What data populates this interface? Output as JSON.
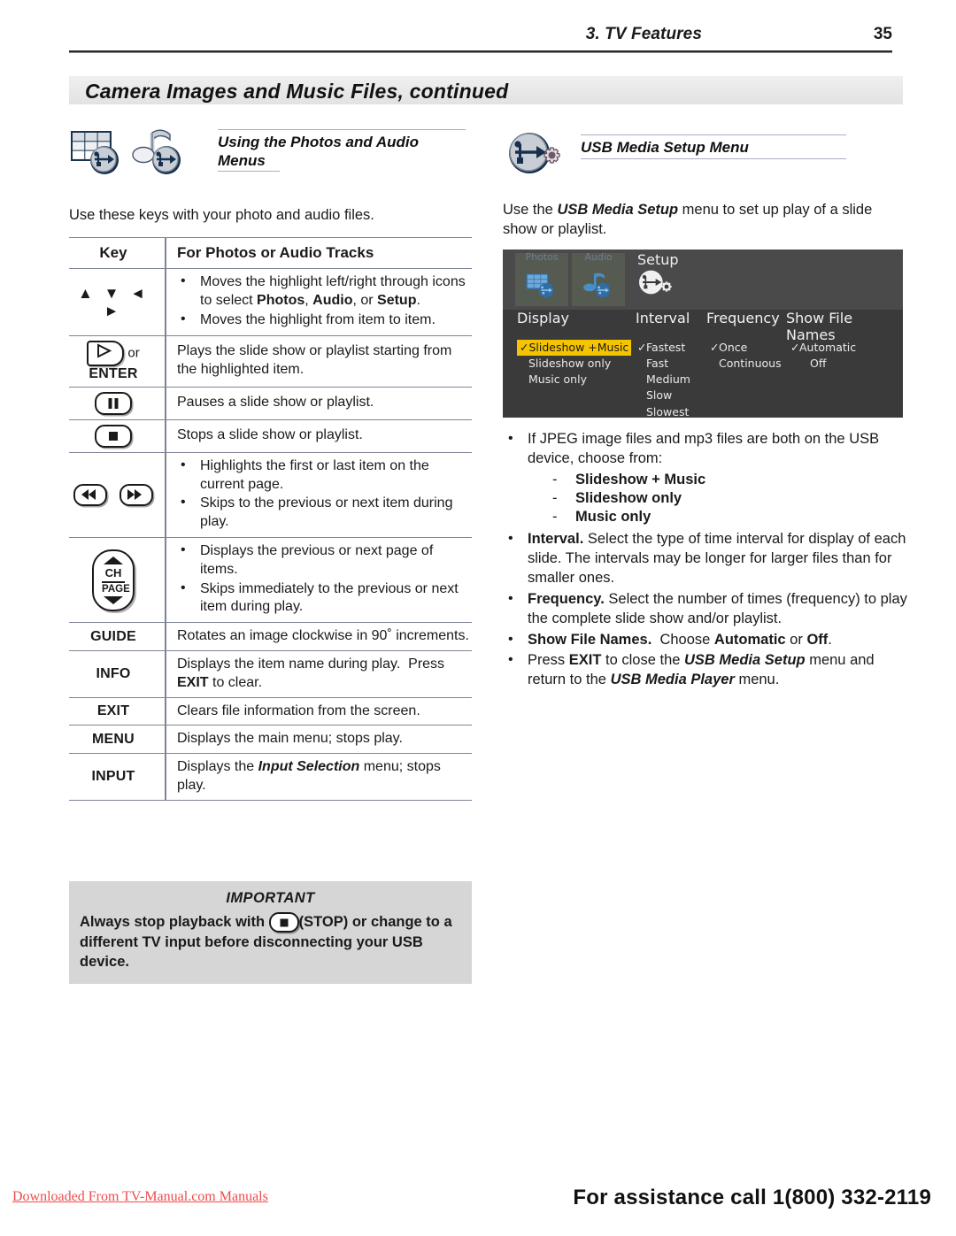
{
  "header": {
    "section": "3.  TV Features",
    "page_number": "35",
    "title": "Camera Images and Music Files, continued"
  },
  "left": {
    "section_title": "Using the Photos and Audio Menus",
    "intro": "Use these keys with your photo and audio files.",
    "icons": [
      "photos-usb-icon",
      "audio-usb-icon"
    ],
    "table": {
      "headers": [
        "Key",
        "For Photos or Audio Tracks"
      ],
      "rows": [
        {
          "key_type": "arrows",
          "key_label": "▲ ▼ ◄ ►",
          "bullets": [
            "Moves the highlight left/right through icons to select Photos, Audio, or Setup.",
            "Moves the highlight from item to item."
          ]
        },
        {
          "key_type": "play-enter",
          "key_label": "ENTER",
          "key_suffix": "or",
          "text": "Plays the slide show or playlist starting from the highlighted item."
        },
        {
          "key_type": "pause",
          "key_label": "",
          "text": "Pauses a slide show or playlist."
        },
        {
          "key_type": "stop",
          "key_label": "",
          "text": "Stops a slide show or playlist."
        },
        {
          "key_type": "rew-ff",
          "key_label": "",
          "bullets": [
            "Highlights the first or last item on the current page.",
            "Skips to the previous or next item during play."
          ]
        },
        {
          "key_type": "ch-page",
          "key_label": "CH PAGE",
          "bullets": [
            "Displays the previous or next page of items.",
            "Skips immediately to the previous or next item during play."
          ]
        },
        {
          "key_type": "text",
          "key_label": "GUIDE",
          "text": "Rotates an image clockwise in 90˚ increments."
        },
        {
          "key_type": "text",
          "key_label": "INFO",
          "text": "Displays the item name during play.  Press EXIT to clear."
        },
        {
          "key_type": "text",
          "key_label": "EXIT",
          "text": "Clears file information from the screen."
        },
        {
          "key_type": "text",
          "key_label": "MENU",
          "text": "Displays the main menu; stops play."
        },
        {
          "key_type": "text",
          "key_label": "INPUT",
          "text": "Displays the Input Selection menu; stops play."
        }
      ]
    },
    "important": {
      "title": "IMPORTANT",
      "body_pre": "Always stop playback with ",
      "body_post": "(STOP) or change to a different TV input before disconnecting your USB device."
    }
  },
  "right": {
    "section_title": "USB Media Setup Menu",
    "icon": "usb-gear-icon",
    "intro_pre": "Use the ",
    "intro_bold": "USB Media Setup",
    "intro_post": " menu to set up play of a slide show or playlist.",
    "tv_menu": {
      "tabs": [
        {
          "label": "Photos",
          "icon": "photos-usb-icon",
          "selected": false
        },
        {
          "label": "Audio",
          "icon": "audio-usb-icon",
          "selected": false
        },
        {
          "label": "Setup",
          "icon": "usb-gear-icon",
          "selected": true
        }
      ],
      "columns": [
        {
          "header": "Display",
          "options": [
            "Slideshow +Music",
            "Slideshow only",
            "Music only"
          ],
          "checked": "Slideshow +Music",
          "highlight": "Slideshow +Music"
        },
        {
          "header": "Interval",
          "options": [
            "Fastest",
            "Fast",
            "Medium",
            "Slow",
            "Slowest"
          ],
          "checked": "Fastest",
          "highlight": ""
        },
        {
          "header": "Frequency",
          "options": [
            "Once",
            "Continuous"
          ],
          "checked": "Once",
          "highlight": ""
        },
        {
          "header": "Show File Names",
          "options": [
            "Automatic",
            "Off"
          ],
          "checked": "Automatic",
          "highlight": ""
        }
      ],
      "highlight_color": "#f5c400",
      "background_color": "#3a3a3a"
    },
    "bullets": [
      {
        "text": "If JPEG image files and mp3 files are both on the USB device, choose from:",
        "sub": [
          "Slideshow + Music",
          "Slideshow only",
          "Music only"
        ]
      },
      {
        "lead": "Interval.",
        "text": "  Select the type of time interval for display of each slide.  The intervals may be longer for larger files than for smaller ones."
      },
      {
        "lead": "Frequency.",
        "text": "  Select the number of times (frequency) to play the complete slide show and/or playlist."
      },
      {
        "lead": "Show File Names.",
        "text": "  Choose Automatic or Off."
      },
      {
        "lead": "",
        "text": "Press EXIT to close the USB Media Setup menu and return to the USB Media Player menu."
      }
    ]
  },
  "footer": {
    "download_note": "Downloaded From TV-Manual.com Manuals",
    "assistance": "For assistance call 1(800) 332-2119"
  }
}
